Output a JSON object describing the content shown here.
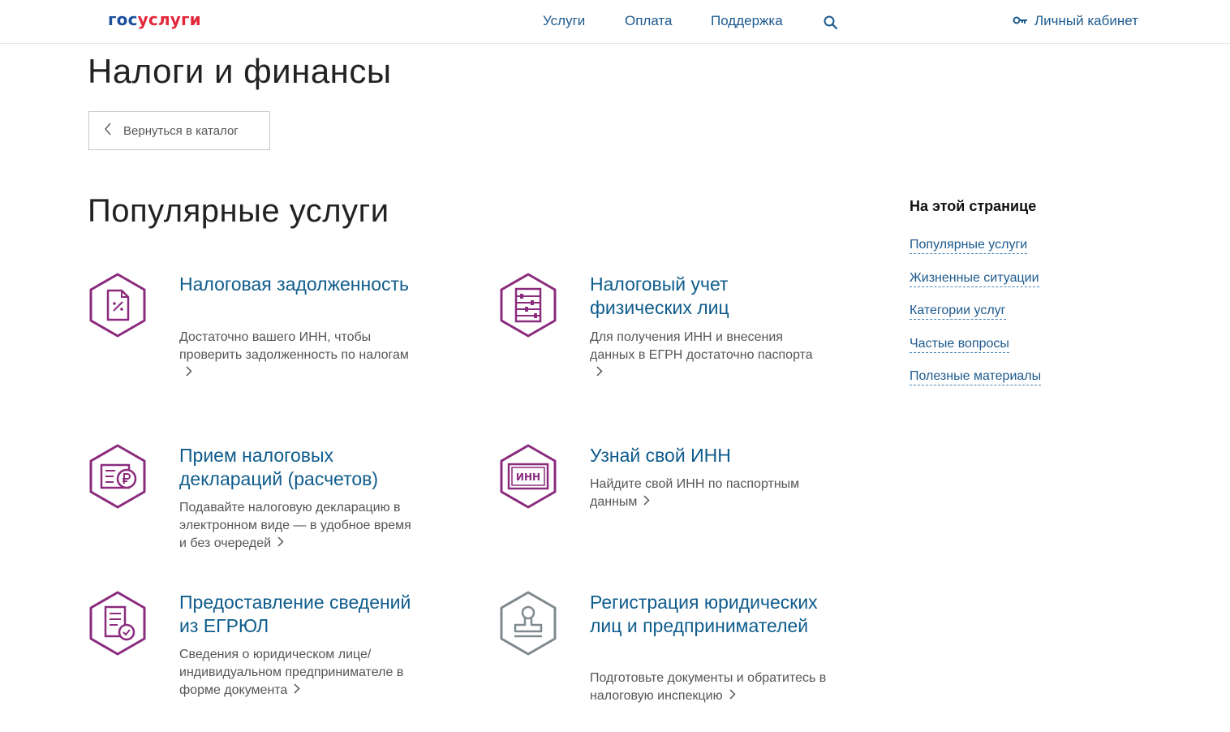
{
  "header": {
    "logo_part1": "гос",
    "logo_part2": "услуги",
    "nav": [
      "Услуги",
      "Оплата",
      "Поддержка"
    ],
    "search_icon": "search-icon",
    "cabinet_label": "Личный кабинет",
    "cabinet_icon": "key-icon"
  },
  "page": {
    "title": "Налоги и финансы",
    "back_label": "Вернуться в каталог",
    "section_title": "Популярные услуги"
  },
  "cards": [
    {
      "title": "Налоговая задолженность",
      "desc": "Достаточно вашего ИНН, чтобы проверить задолженность по налогам",
      "icon": "tax-document-icon"
    },
    {
      "title": "Налоговый учет физических лиц",
      "desc": "Для получения ИНН и внесения данных в ЕГРН достаточно паспорта",
      "icon": "abacus-icon"
    },
    {
      "title": "Прием налоговых деклараций (расчетов)",
      "desc": "Подавайте налоговую декларацию в электронном виде — в удобное время и без очередей",
      "icon": "ruble-document-icon"
    },
    {
      "title": "Узнай свой ИНН",
      "desc": "Найдите свой ИНН по паспортным данным",
      "icon": "inn-card-icon"
    },
    {
      "title": "Предоставление сведений из ЕГРЮЛ",
      "desc": "Сведения о юридическом лице/ индивидуальном предпринимателе в форме документа",
      "icon": "document-check-icon"
    },
    {
      "title": "Регистрация юридических лиц и предпринимателей",
      "desc": "Подготовьте документы и обратитесь в налоговую инспекцию",
      "icon": "stamp-icon"
    }
  ],
  "sidebar": {
    "title": "На этой странице",
    "links": [
      "Популярные услуги",
      "Жизненные ситуации",
      "Категории услуг",
      "Частые вопросы",
      "Полезные материалы"
    ]
  },
  "colors": {
    "accent_purple": "#8a2b7d",
    "link_blue": "#1d5a8e",
    "title_blue": "#0f5c8c",
    "icon_gray": "#7f8a8e",
    "logo_red": "#e3283b"
  }
}
